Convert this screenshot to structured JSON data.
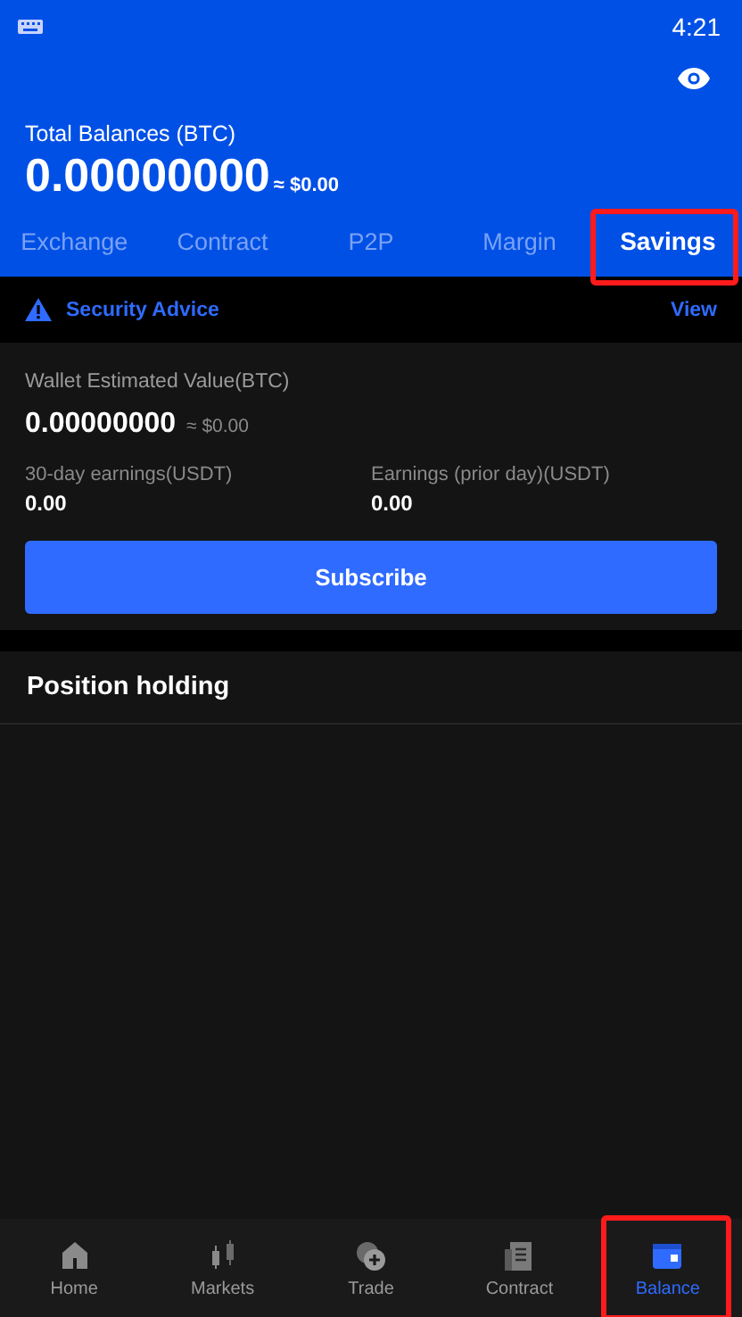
{
  "status_bar": {
    "time": "4:21"
  },
  "header": {
    "title": "Total Balances (BTC)",
    "amount": "0.00000000",
    "fiat": "≈ $0.00"
  },
  "tabs": [
    {
      "label": "Exchange",
      "selected": false,
      "highlighted": false
    },
    {
      "label": "Contract",
      "selected": false,
      "highlighted": false
    },
    {
      "label": "P2P",
      "selected": false,
      "highlighted": false
    },
    {
      "label": "Margin",
      "selected": false,
      "highlighted": false
    },
    {
      "label": "Savings",
      "selected": true,
      "highlighted": true
    }
  ],
  "notice": {
    "text": "Security Advice",
    "action": "View"
  },
  "wallet": {
    "label": "Wallet Estimated Value(BTC)",
    "amount": "0.00000000",
    "fiat": "≈ $0.00",
    "stats": [
      {
        "label": "30-day earnings(USDT)",
        "value": "0.00"
      },
      {
        "label": "Earnings (prior day)(USDT)",
        "value": "0.00"
      }
    ],
    "button": "Subscribe"
  },
  "section_title": "Position holding",
  "nav": [
    {
      "label": "Home",
      "kind": "home",
      "selected": false,
      "highlighted": false
    },
    {
      "label": "Markets",
      "kind": "markets",
      "selected": false,
      "highlighted": false
    },
    {
      "label": "Trade",
      "kind": "trade",
      "selected": false,
      "highlighted": false
    },
    {
      "label": "Contract",
      "kind": "contract",
      "selected": false,
      "highlighted": false
    },
    {
      "label": "Balance",
      "kind": "balance",
      "selected": true,
      "highlighted": true
    }
  ]
}
